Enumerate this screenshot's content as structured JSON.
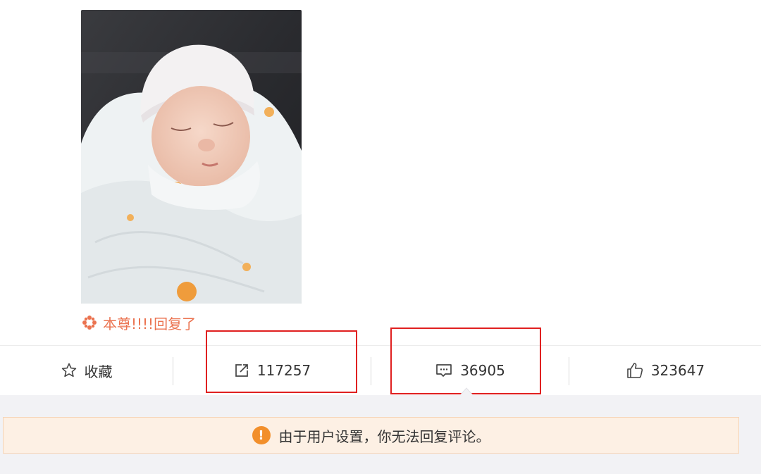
{
  "post": {
    "image_alt": "sleeping baby wrapped in white blanket",
    "reply_text": "本尊!!!!回复了"
  },
  "actions": {
    "favorite_label": "收藏",
    "repost_count": "117257",
    "comment_count": "36905",
    "like_count": "323647"
  },
  "notice": {
    "text": "由于用户设置，你无法回复评论。"
  },
  "colors": {
    "accent_orange": "#eb7350",
    "highlight_box": "#e02020",
    "notice_bg": "#fdf0e4",
    "warning_icon": "#f28f2b"
  }
}
